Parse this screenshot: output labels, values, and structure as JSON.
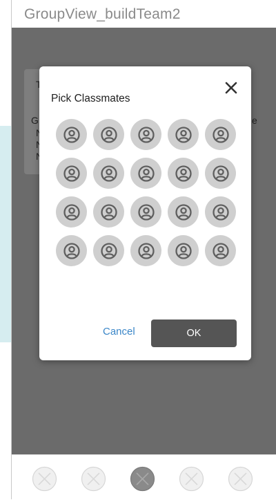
{
  "window": {
    "title": "GroupView_buildTeam2"
  },
  "dialog": {
    "title": "Pick Classmates",
    "cancel_label": "Cancel",
    "ok_label": "OK",
    "grid": {
      "rows": 4,
      "cols": 5
    }
  },
  "background_card": {
    "partial_letters": [
      "T",
      "G",
      "N",
      "N",
      "N",
      "e"
    ]
  },
  "bottom_nav": {
    "count": 5,
    "active_index": 2
  },
  "colors": {
    "overlay": "#6b6b6b",
    "avatar_bg": "#cfcfcf",
    "avatar_icon": "#5f5f5f",
    "ok_button": "#555555",
    "cancel_text": "#3a86c8"
  }
}
